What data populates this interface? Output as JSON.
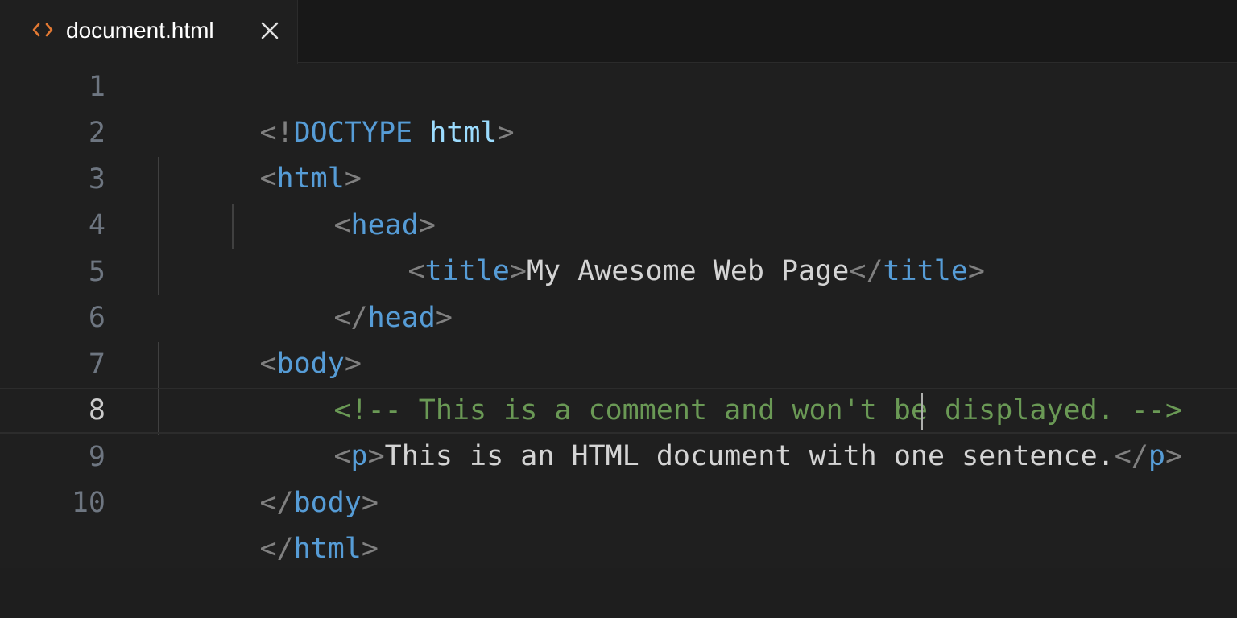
{
  "tab": {
    "filename": "document.html",
    "icon": "html-file-icon",
    "close_icon": "close-icon",
    "icon_color": "#e37933"
  },
  "editor": {
    "active_line": 8,
    "lines": [
      {
        "number": "1",
        "tokens": [
          "<!",
          "DOCTYPE",
          " ",
          "html",
          ">"
        ]
      },
      {
        "number": "2",
        "tokens": [
          "<",
          "html",
          ">"
        ]
      },
      {
        "number": "3",
        "tokens": [
          "<",
          "head",
          ">"
        ]
      },
      {
        "number": "4",
        "tokens": [
          "<",
          "title",
          ">",
          "My Awesome Web Page",
          "</",
          "title",
          ">"
        ]
      },
      {
        "number": "5",
        "tokens": [
          "</",
          "head",
          ">"
        ]
      },
      {
        "number": "6",
        "tokens": [
          "<",
          "body",
          ">"
        ]
      },
      {
        "number": "7",
        "tokens": [
          "<!-- This is a comment and won't be displayed. -->"
        ]
      },
      {
        "number": "8",
        "tokens": [
          "<",
          "p",
          ">",
          "This is an HTML document with one sentence.",
          "</",
          "p",
          ">"
        ]
      },
      {
        "number": "9",
        "tokens": [
          "</",
          "body",
          ">"
        ]
      },
      {
        "number": "10",
        "tokens": [
          "</",
          "html",
          ">"
        ]
      }
    ]
  },
  "colors": {
    "background": "#1f1f1f",
    "tag": "#569cd6",
    "punctuation": "#808080",
    "text": "#d4d4d4",
    "comment": "#6a9955",
    "doctype_attr": "#9cdcfe"
  }
}
